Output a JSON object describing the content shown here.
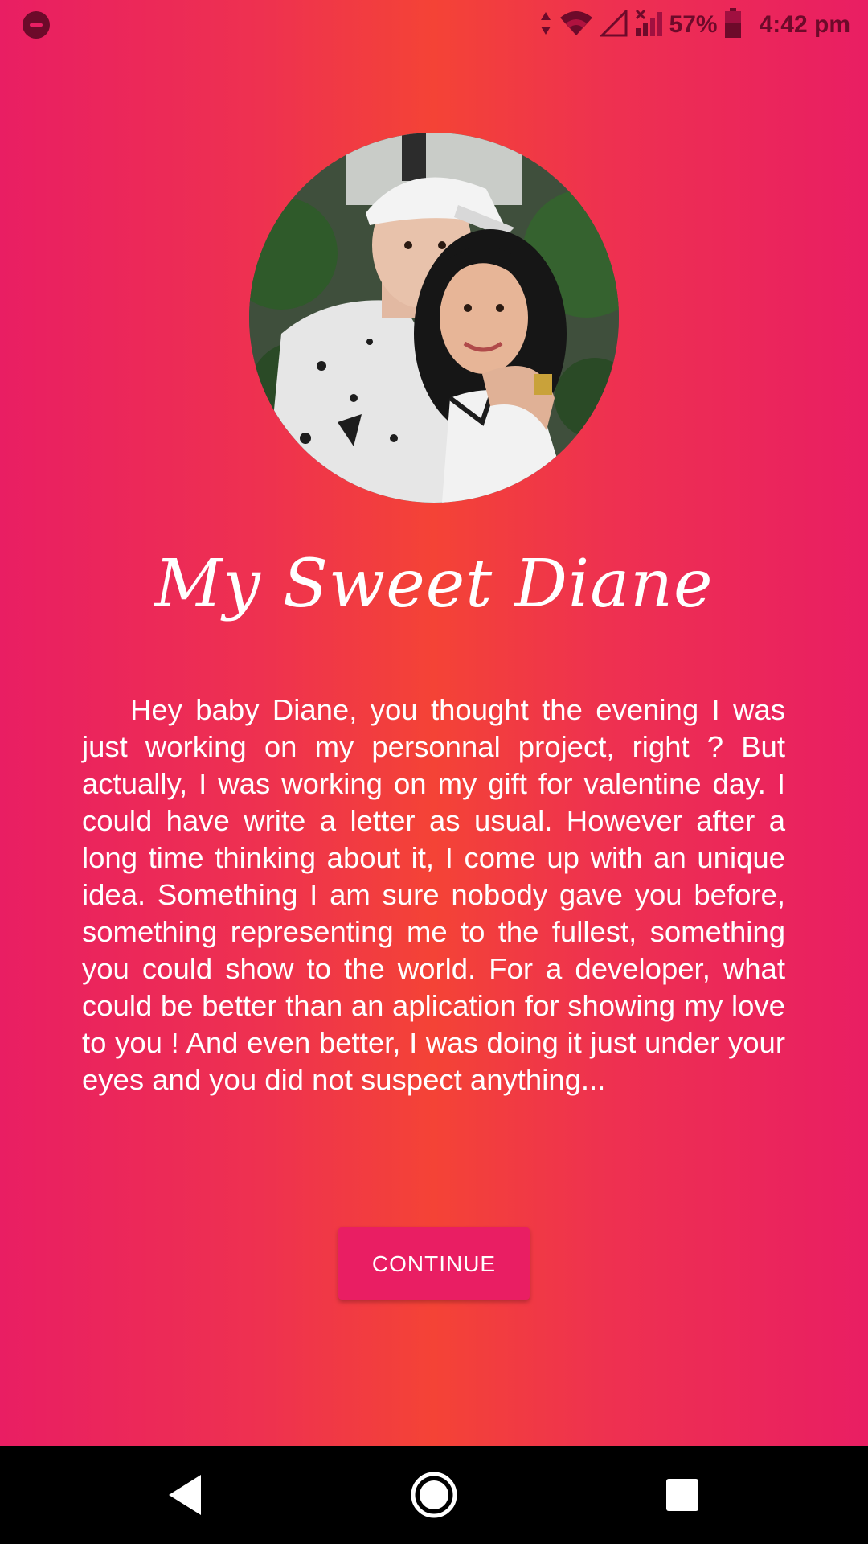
{
  "status_bar": {
    "battery": "57%",
    "time": "4:42 pm",
    "icons": [
      "do-not-disturb-icon",
      "data-arrows-icon",
      "wifi-icon",
      "signal-icon",
      "signal-no-data-icon",
      "battery-icon"
    ]
  },
  "avatar": {
    "icon": "couple-photo"
  },
  "title": "My Sweet Diane",
  "message": "Hey baby Diane, you thought the evening I was just working on my personnal project, right ? But actually, I was working on my gift for valentine day. I could have write a letter as usual. However after a long time thinking about it, I come up with an unique idea. Something I am sure nobody gave you before, something representing me to the fullest, something you could show to the world. For a developer, what could be better than an aplication for showing my love to you ! And even better, I was doing it just under your eyes and you did not suspect anything...",
  "continue_button": {
    "label": "CONTINUE"
  },
  "nav_bar": {
    "icons": [
      "back-icon",
      "home-icon",
      "recents-icon"
    ]
  },
  "colors": {
    "background_edge": "#e91e63",
    "background_center": "#f44336",
    "button": "#e91e63",
    "text": "#ffffff",
    "status_icons": "#6d0a2a"
  }
}
